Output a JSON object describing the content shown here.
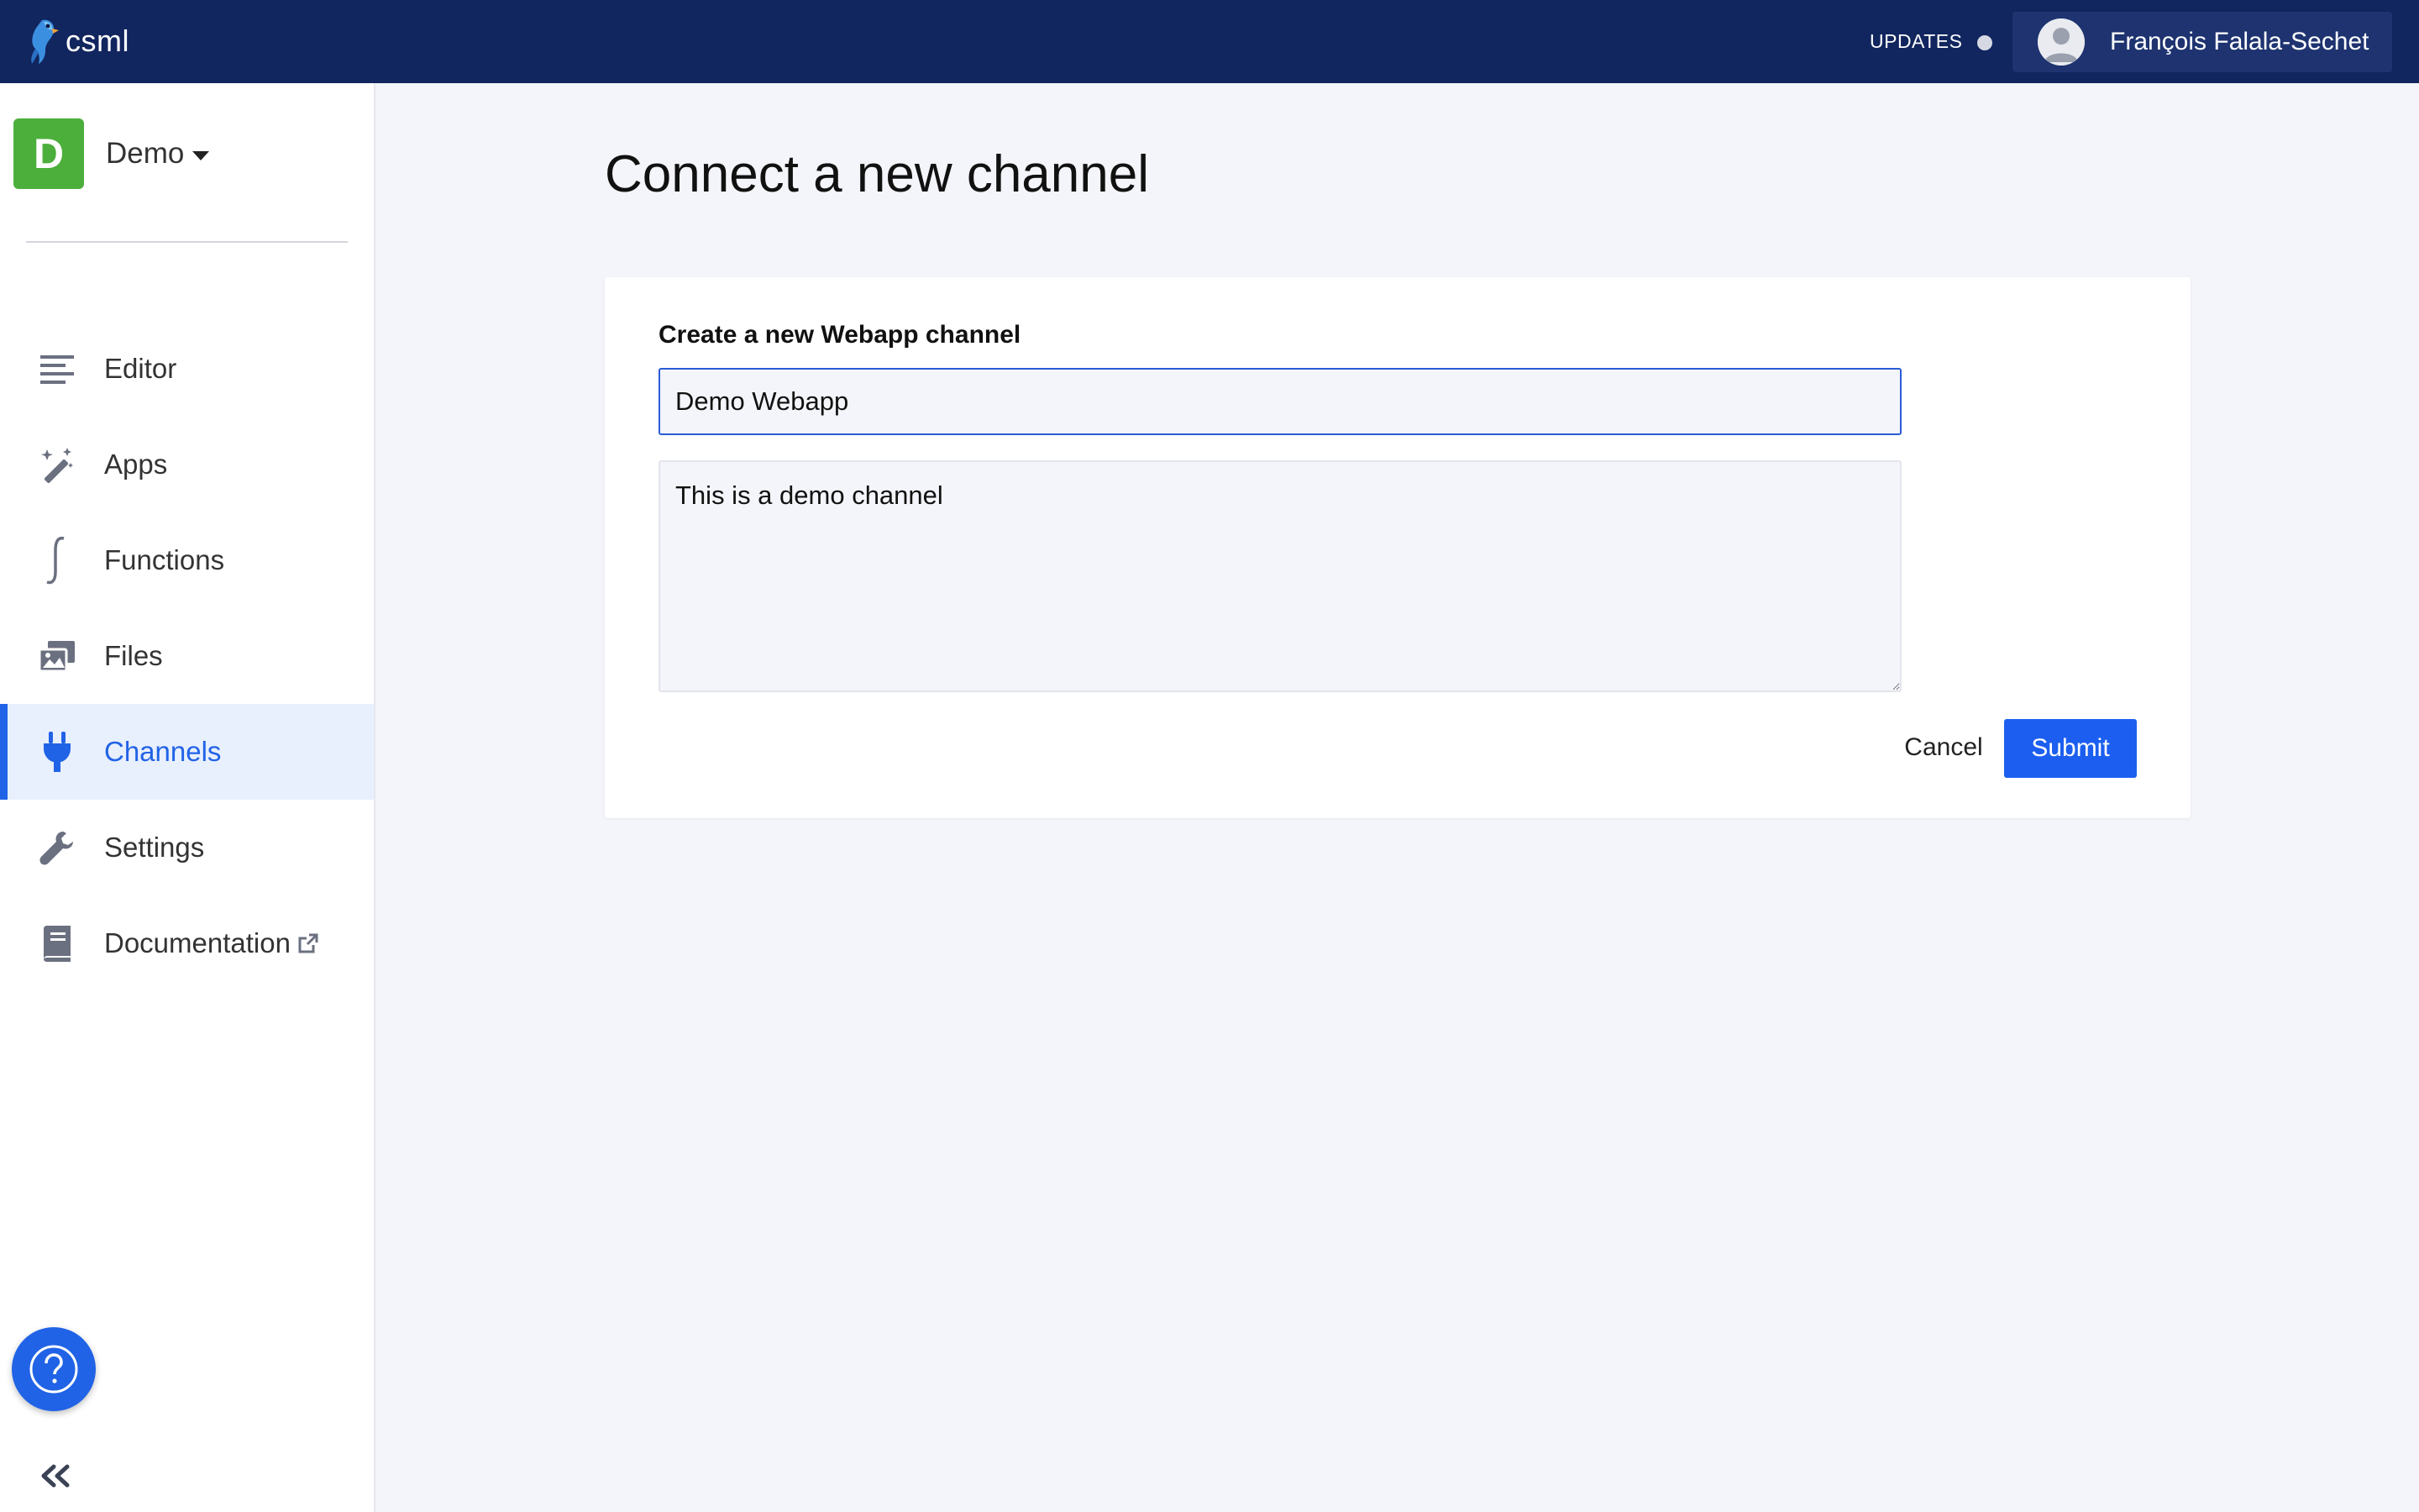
{
  "app": {
    "brand_name": "csml",
    "updates_label": "UPDATES",
    "user_name": "François Falala-Sechet"
  },
  "sidebar": {
    "project_initial": "D",
    "project_name": "Demo",
    "items": [
      {
        "label": "Editor",
        "icon": "editor-lines-icon",
        "active": false
      },
      {
        "label": "Apps",
        "icon": "magic-wand-icon",
        "active": false
      },
      {
        "label": "Functions",
        "icon": "function-icon",
        "active": false
      },
      {
        "label": "Files",
        "icon": "files-icon",
        "active": false
      },
      {
        "label": "Channels",
        "icon": "plug-icon",
        "active": true
      },
      {
        "label": "Settings",
        "icon": "wrench-icon",
        "active": false
      },
      {
        "label": "Documentation",
        "icon": "book-icon",
        "active": false
      }
    ]
  },
  "main": {
    "title": "Connect a new channel",
    "form": {
      "heading": "Create a new Webapp channel",
      "name_value": "Demo Webapp",
      "description_value": "This is a demo channel",
      "cancel_label": "Cancel",
      "submit_label": "Submit"
    }
  },
  "colors": {
    "topbar": "#11255e",
    "accent": "#2163e6",
    "project_badge": "#4caf3c",
    "active_nav_bg": "#e8effd"
  }
}
